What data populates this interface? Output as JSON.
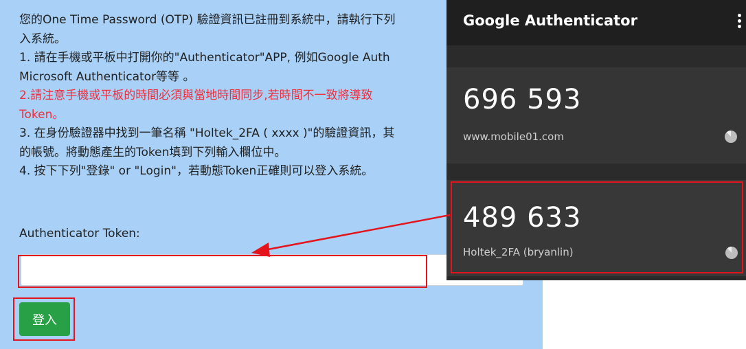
{
  "login": {
    "instructions": [
      {
        "text": "您的One Time Password (OTP) 驗證資訊已註冊到系統中，請執行下列",
        "warn": false
      },
      {
        "text": "入系統。",
        "warn": false
      },
      {
        "text": "1. 請在手機或平板中打開你的\"Authenticator\"APP, 例如Google Auth",
        "warn": false
      },
      {
        "text": "Microsoft Authenticator等等 。",
        "warn": false
      },
      {
        "text": "2.請注意手機或平板的時間必須與當地時間同步,若時間不一致將導致",
        "warn": true
      },
      {
        "text": "Token。",
        "warn": true
      },
      {
        "text": "3. 在身份驗證器中找到一筆名稱 \"Holtek_2FA ( xxxx )\"的驗證資訊，其",
        "warn": false
      },
      {
        "text": "的帳號。將動態產生的Token填到下列輸入欄位中。",
        "warn": false
      },
      {
        "text": "4. 按下下列\"登錄\" or \"Login\"，若動態Token正確則可以登入系統。",
        "warn": false
      }
    ],
    "token_label": "Authenticator Token:",
    "token_value": "",
    "token_placeholder": "",
    "login_button": "登入",
    "warn_color": "#ef2f3c",
    "button_color": "#27a046",
    "highlight_color": "#e3141b"
  },
  "authenticator": {
    "title": "Google Authenticator",
    "menu_icon": "more-vert-icon",
    "accounts": [
      {
        "code": "696 593",
        "account": "www.mobile01.com"
      },
      {
        "code": "489 633",
        "account": "Holtek_2FA (bryanlin)"
      }
    ]
  }
}
